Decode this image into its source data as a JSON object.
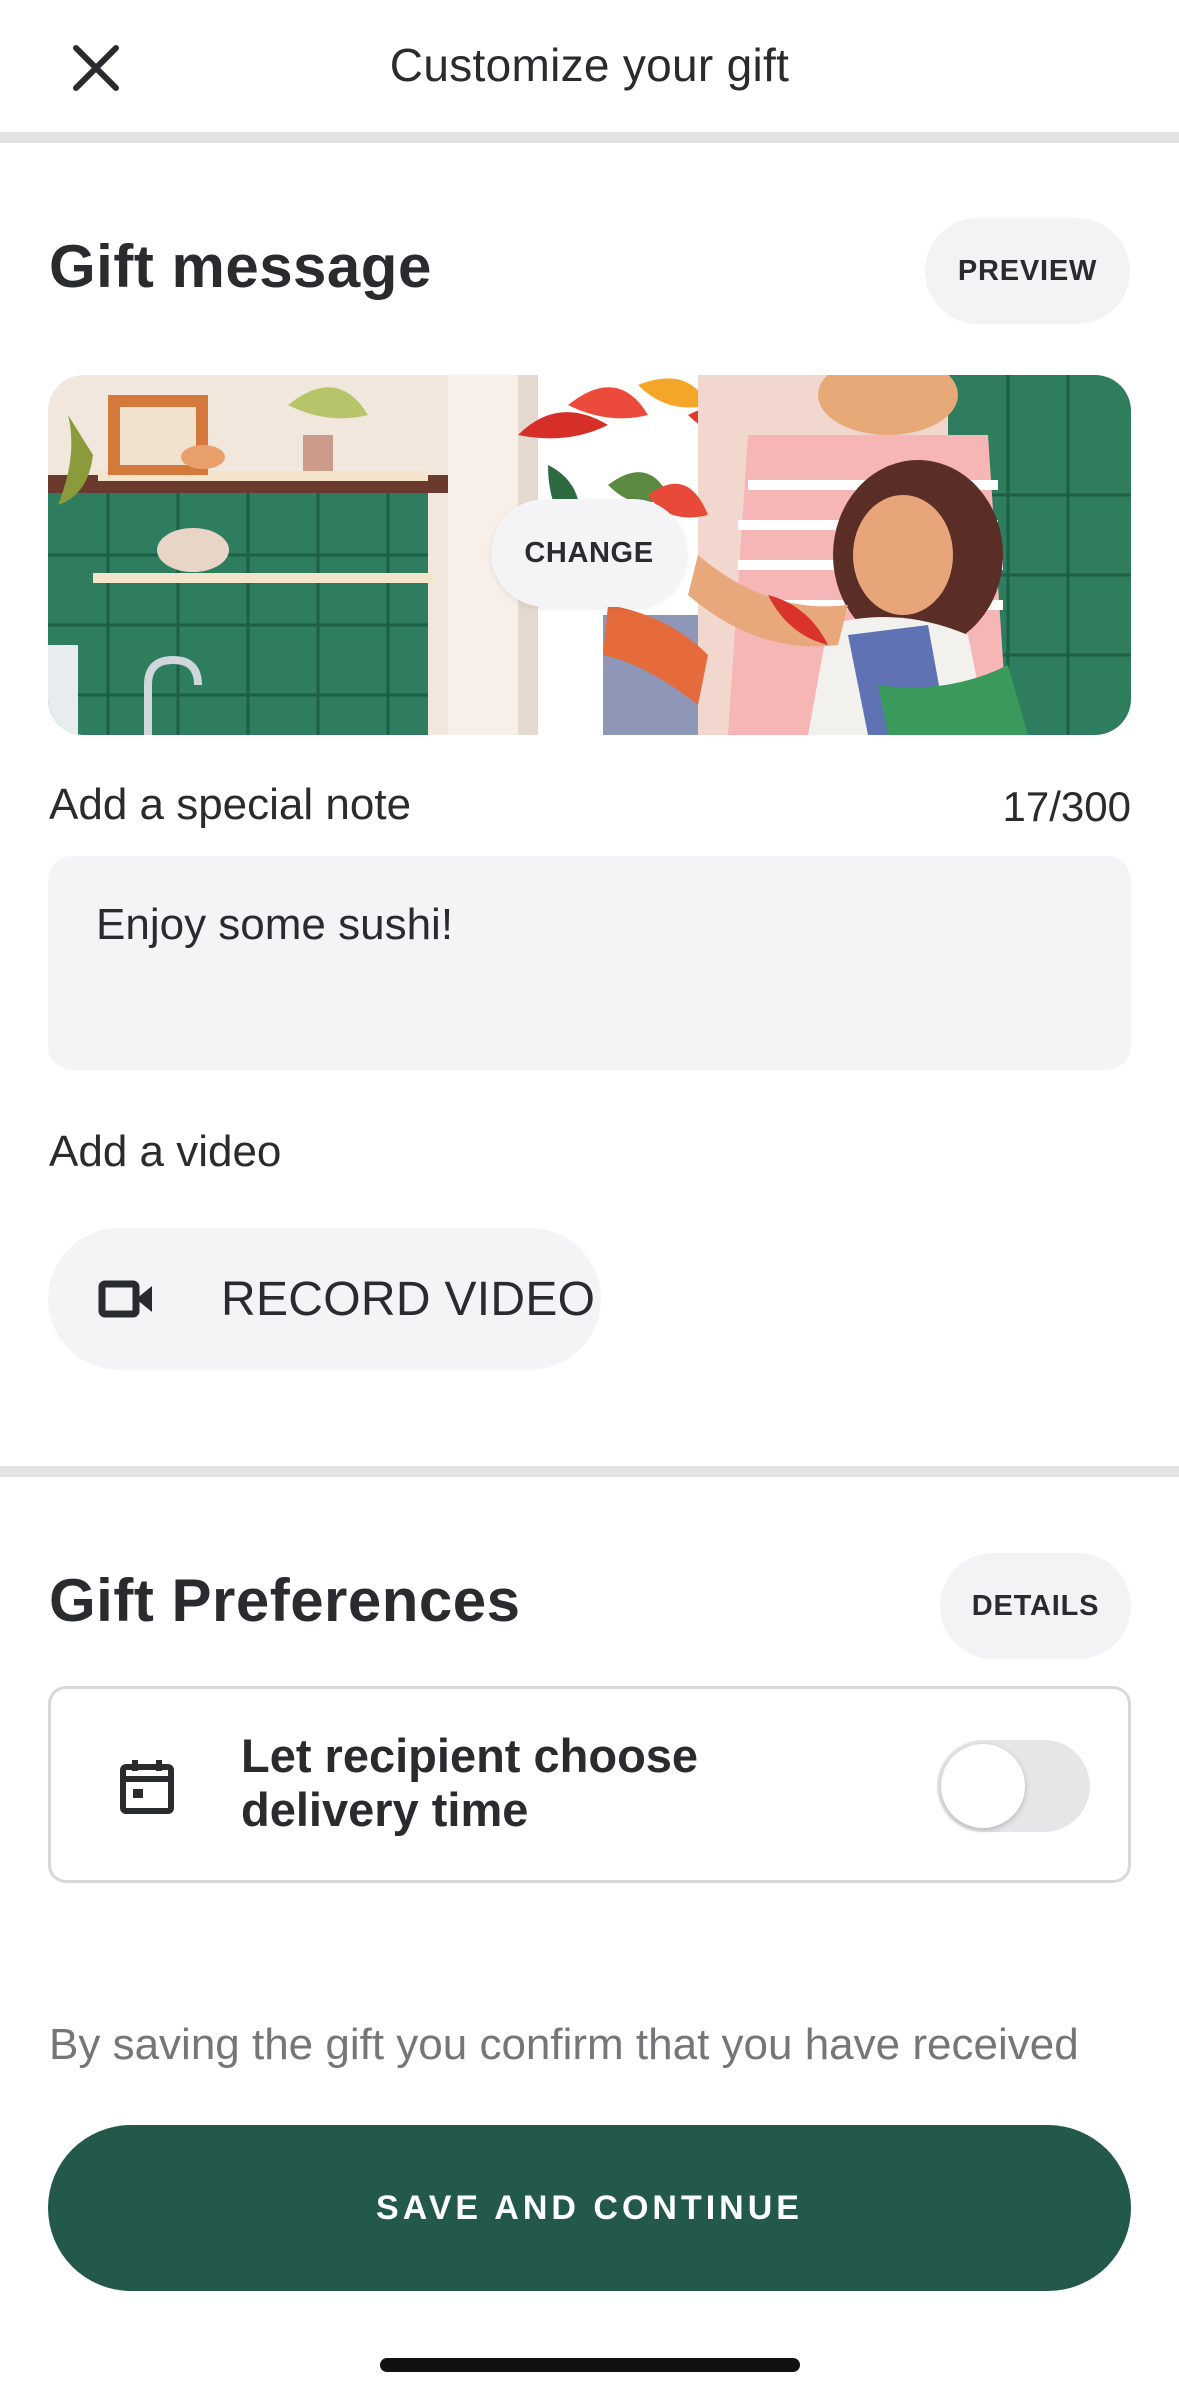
{
  "header": {
    "title": "Customize your gift",
    "close_icon": "close-icon"
  },
  "gift_message": {
    "title": "Gift message",
    "preview_label": "PREVIEW",
    "change_label": "CHANGE",
    "note_label": "Add a special note",
    "char_count": "17/300",
    "note_value": "Enjoy some sushi!",
    "video_label": "Add a video",
    "record_label": "RECORD VIDEO",
    "record_icon": "video-camera-icon"
  },
  "gift_preferences": {
    "title": "Gift Preferences",
    "details_label": "DETAILS",
    "delivery_option": {
      "label": "Let recipient choose delivery time",
      "icon": "calendar-icon",
      "enabled": false
    }
  },
  "disclaimer": "By saving the  gift you confirm that you have received",
  "footer": {
    "save_label": "SAVE AND CONTINUE"
  },
  "colors": {
    "primary": "#22594a",
    "surface": "#f4f4f6",
    "text": "#2a2b2e",
    "muted_text": "#75767a",
    "divider": "#e3e3e6"
  }
}
